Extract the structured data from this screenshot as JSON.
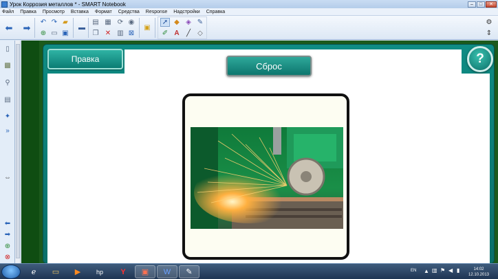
{
  "window": {
    "title": "Урок Коррозия металлов * - SMART Notebook",
    "minimize": "–",
    "maximize": "□",
    "close": "✕"
  },
  "menu": [
    "Файл",
    "Правка",
    "Просмотр",
    "Вставка",
    "Формат",
    "Средства",
    "Response",
    "Надстройки",
    "Справка"
  ],
  "canvas": {
    "edit_button": "Правка",
    "reset_button": "Сброс",
    "help_button": "?"
  },
  "tray": {
    "language": "EN",
    "time": "14:02",
    "date": "12.10.2013"
  },
  "colors": {
    "teal": "#0f8c84",
    "dark_green": "#0f4d12",
    "taskbar": "#2a4566"
  }
}
